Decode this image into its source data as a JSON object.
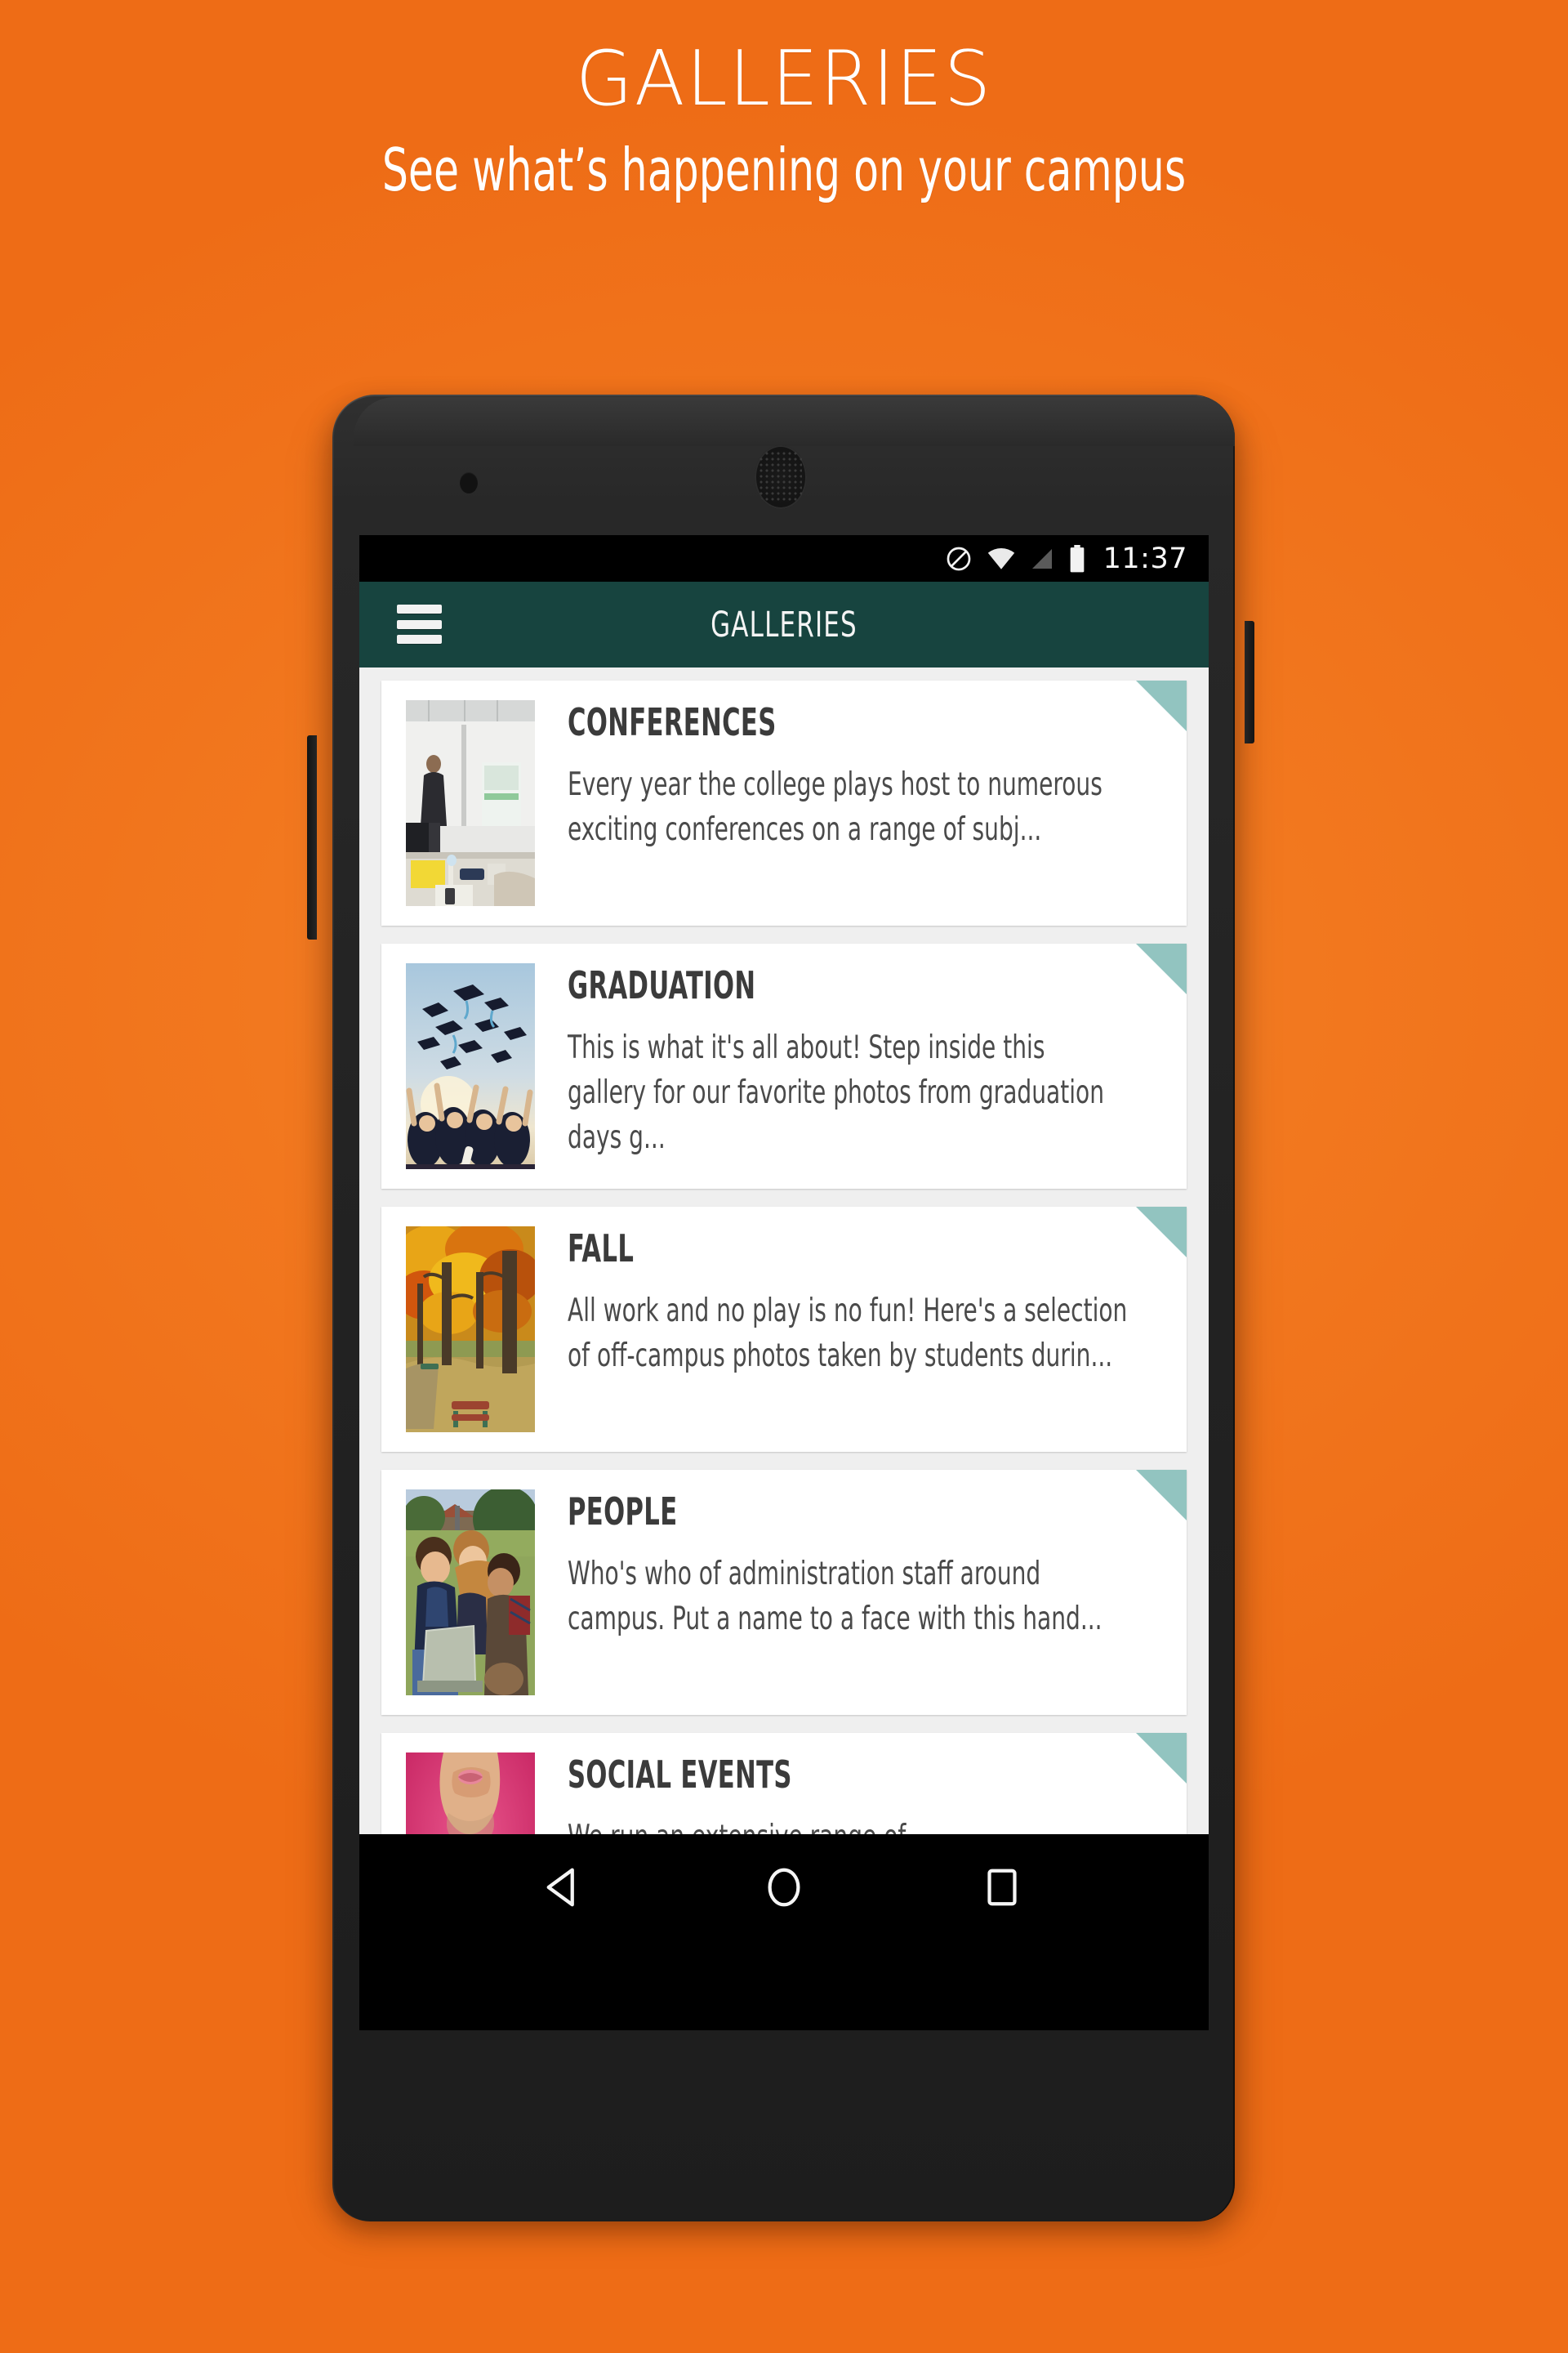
{
  "promo": {
    "title": "GALLERIES",
    "subtitle": "See what’s happening on your campus"
  },
  "colors": {
    "background_orange": "#f2781f",
    "appbar_teal": "#17443f",
    "corner_flag_teal": "#92c4c0",
    "list_background": "#efefef",
    "card_background": "#ffffff",
    "title_text": "#3b3b3b",
    "body_text": "#4a4a4a"
  },
  "device": {
    "status_bar": {
      "time": "11:37",
      "icons": [
        "do-not-disturb-icon",
        "wifi-icon",
        "cellular-signal-icon",
        "battery-icon"
      ]
    },
    "app_bar": {
      "menu_icon": "hamburger-menu-icon",
      "title": "GALLERIES"
    },
    "nav_bar": {
      "back": "back-triangle-icon",
      "home": "home-circle-icon",
      "recents": "recents-square-icon"
    }
  },
  "galleries": [
    {
      "title": "CONFERENCES",
      "description": "Every year the college plays host to numerous exciting conferences on a range of subj...",
      "thumbnail": "lecturer-presenting-in-classroom"
    },
    {
      "title": "GRADUATION",
      "description": "This is what it's all about!  Step inside this gallery for our favorite photos from graduation days g...",
      "thumbnail": "graduates-throwing-mortarboards"
    },
    {
      "title": "FALL",
      "description": "All work and no play is no fun! Here's a selection of off-campus photos taken by students durin...",
      "thumbnail": "autumn-trees-park-path"
    },
    {
      "title": "PEOPLE",
      "description": "Who's who of administration staff around campus.  Put a name to a face with this hand...",
      "thumbnail": "students-with-laptop-on-grass"
    },
    {
      "title": "SOCIAL EVENTS",
      "description": "We run an extensive range of",
      "thumbnail": "man-with-bow-tie-pink-background"
    }
  ]
}
